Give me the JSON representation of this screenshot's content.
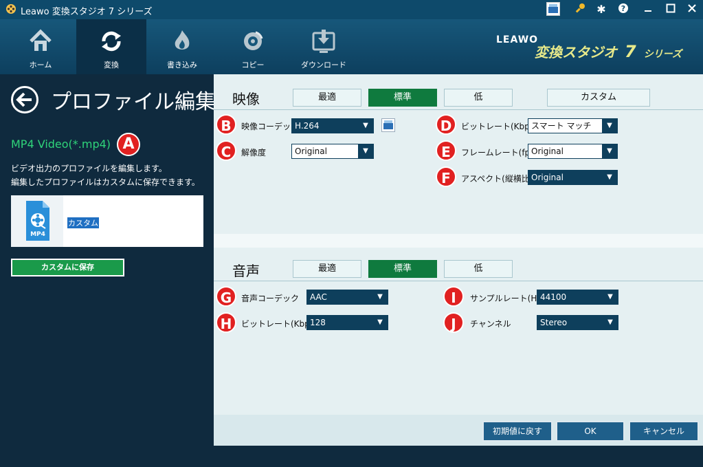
{
  "window": {
    "title": "Leawo 変換スタジオ 7 シリーズ"
  },
  "nav": {
    "tabs": [
      {
        "label": "ホーム",
        "icon": "home-icon"
      },
      {
        "label": "変換",
        "icon": "convert-icon"
      },
      {
        "label": "書き込み",
        "icon": "burn-icon"
      },
      {
        "label": "コピー",
        "icon": "disc-icon"
      },
      {
        "label": "ダウンロード",
        "icon": "download-icon"
      }
    ],
    "active": "変換"
  },
  "brand": {
    "leawo": "LEAWO",
    "product": "変換スタジオ",
    "seven": "7",
    "series": "シリーズ"
  },
  "left": {
    "title": "プロファイル編集",
    "profile": "MP4 Video(*.mp4)",
    "desc1": "ビデオ出力のプロファイルを編集します。",
    "desc2": "編集したプロファイルはカスタムに保存できます。",
    "card_tag": "MP4",
    "card_label": "カスタム",
    "save": "カスタムに保存"
  },
  "markers": [
    "A",
    "B",
    "C",
    "D",
    "E",
    "F",
    "G",
    "H",
    "I",
    "J"
  ],
  "video": {
    "title": "映像",
    "tiers": [
      "最適",
      "標準",
      "低",
      "カスタム"
    ],
    "selected": "標準",
    "codec_label": "映像コーデック",
    "codec": "H.264",
    "res_label": "解像度",
    "res": "Original",
    "bitrate_label": "ビットレート(Kbps)",
    "bitrate": "スマート マッチ",
    "fps_label": "フレームレート(fps)",
    "fps": "Original",
    "aspect_label": "アスペクト(縦横比)",
    "aspect": "Original"
  },
  "audio": {
    "title": "音声",
    "tiers": [
      "最適",
      "標準",
      "低"
    ],
    "selected": "標準",
    "codec_label": "音声コーデック",
    "codec": "AAC",
    "bitrate_label": "ビットレート(Kbps)",
    "bitrate": "128",
    "rate_label": "サンプルレート(Hz)",
    "rate": "44100",
    "channel_label": "チャンネル",
    "channel": "Stereo"
  },
  "footer": {
    "reset": "初期値に戻す",
    "ok": "OK",
    "cancel": "キャンセル"
  },
  "colors": {
    "accent_green": "#0f7a3e",
    "marker_red": "#e12121",
    "nav_dark": "#0f2a3e"
  }
}
